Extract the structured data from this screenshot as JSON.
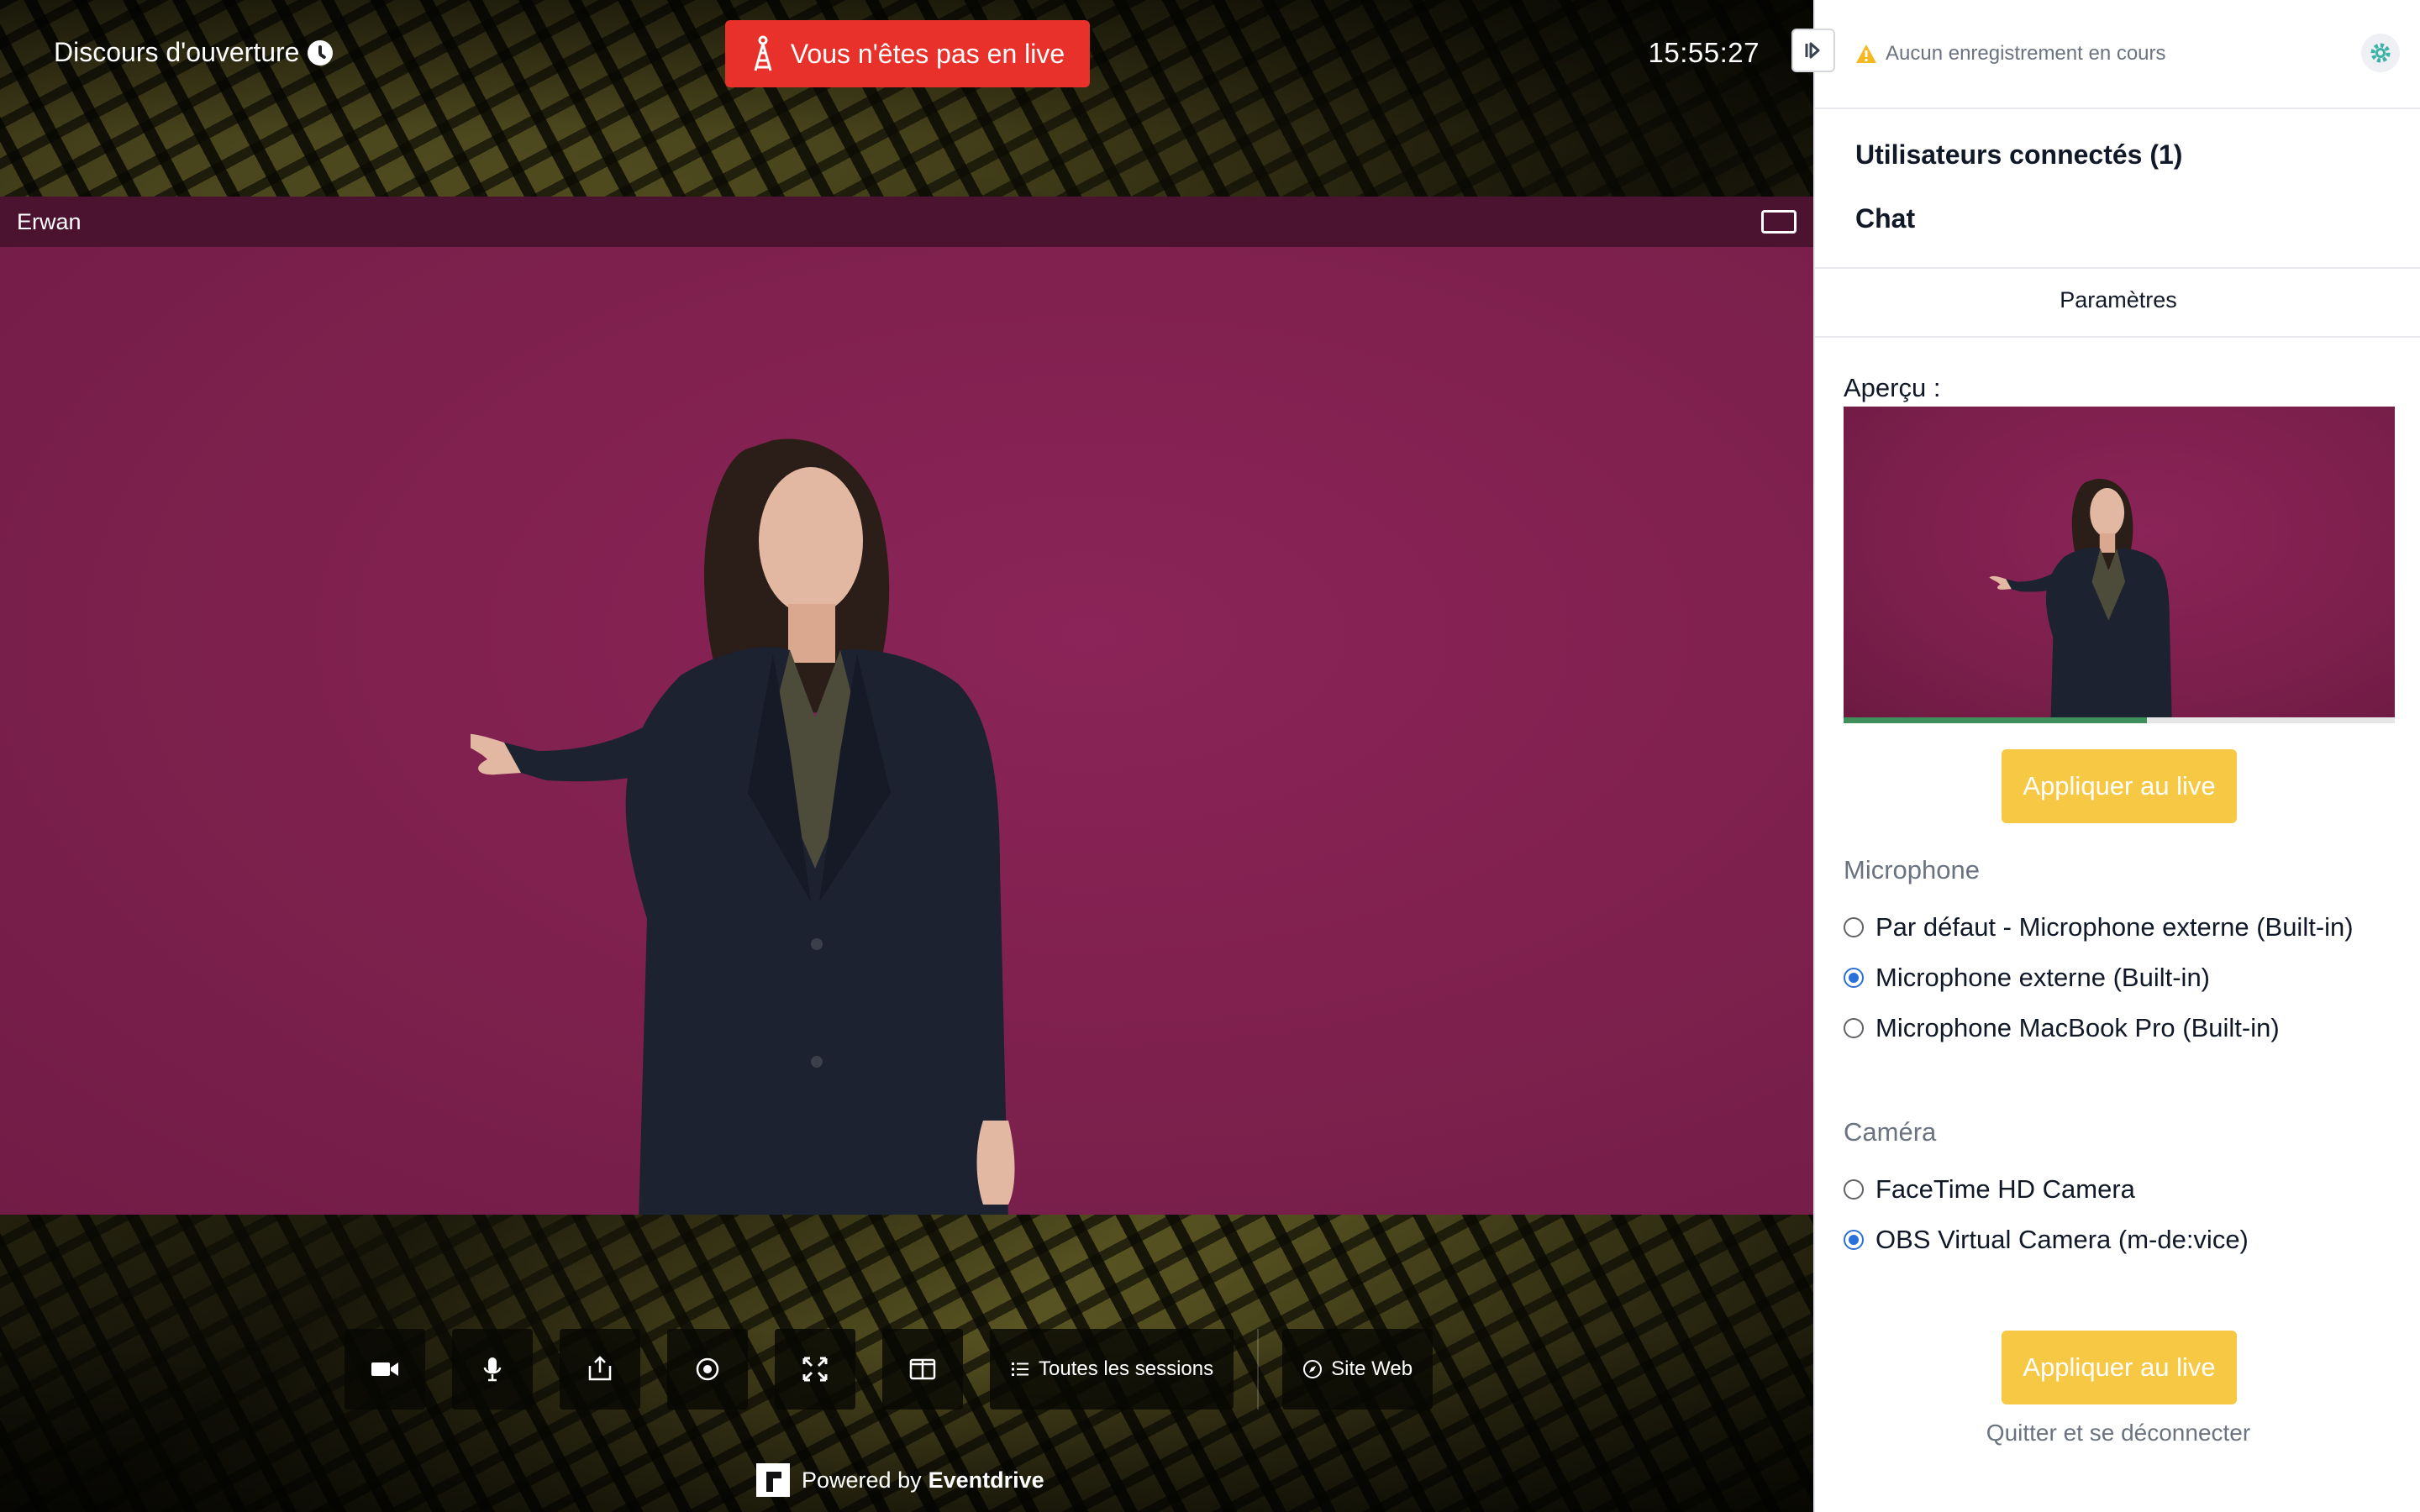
{
  "stage": {
    "session_title": "Discours d'ouverture",
    "live_status": "Vous n'êtes pas en live",
    "time": "15:55:27",
    "video": {
      "participant_name": "Erwan"
    },
    "controls": {
      "all_sessions": "Toutes les sessions",
      "website": "Site Web"
    },
    "footer": {
      "powered_prefix": "Powered by",
      "brand": "Eventdrive"
    }
  },
  "sidebar": {
    "recording_status": "Aucun enregistrement en cours",
    "nav": {
      "connected_users": "Utilisateurs connectés (1)",
      "chat": "Chat"
    },
    "settings_tab": "Paramètres",
    "preview": {
      "label": "Aperçu :",
      "audio_level": 0.55
    },
    "apply_label": "Appliquer au live",
    "microphone": {
      "title": "Microphone",
      "options": [
        {
          "label": "Par défaut - Microphone externe (Built-in)",
          "selected": false
        },
        {
          "label": "Microphone externe (Built-in)",
          "selected": true
        },
        {
          "label": "Microphone MacBook Pro (Built-in)",
          "selected": false
        }
      ]
    },
    "camera": {
      "title": "Caméra",
      "options": [
        {
          "label": "FaceTime HD Camera",
          "selected": false
        },
        {
          "label": "OBS Virtual Camera (m-de:vice)",
          "selected": true
        }
      ]
    },
    "quit_label": "Quitter et se déconnecter"
  },
  "colors": {
    "live_red": "#e8312a",
    "apply_yellow": "#f7c843",
    "video_bg": "#80214f",
    "header_bar": "#4b1330",
    "progress_green": "#3f8f5b"
  }
}
